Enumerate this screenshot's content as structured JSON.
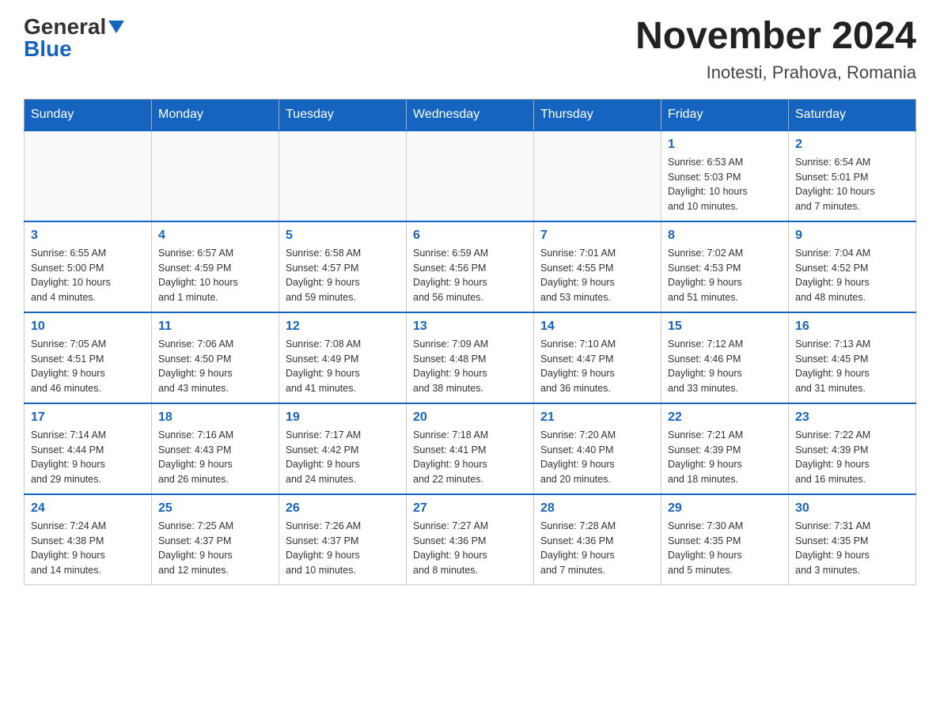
{
  "header": {
    "logo_general": "General",
    "logo_blue": "Blue",
    "title": "November 2024",
    "subtitle": "Inotesti, Prahova, Romania"
  },
  "weekdays": [
    "Sunday",
    "Monday",
    "Tuesday",
    "Wednesday",
    "Thursday",
    "Friday",
    "Saturday"
  ],
  "weeks": [
    [
      {
        "day": "",
        "info": ""
      },
      {
        "day": "",
        "info": ""
      },
      {
        "day": "",
        "info": ""
      },
      {
        "day": "",
        "info": ""
      },
      {
        "day": "",
        "info": ""
      },
      {
        "day": "1",
        "info": "Sunrise: 6:53 AM\nSunset: 5:03 PM\nDaylight: 10 hours\nand 10 minutes."
      },
      {
        "day": "2",
        "info": "Sunrise: 6:54 AM\nSunset: 5:01 PM\nDaylight: 10 hours\nand 7 minutes."
      }
    ],
    [
      {
        "day": "3",
        "info": "Sunrise: 6:55 AM\nSunset: 5:00 PM\nDaylight: 10 hours\nand 4 minutes."
      },
      {
        "day": "4",
        "info": "Sunrise: 6:57 AM\nSunset: 4:59 PM\nDaylight: 10 hours\nand 1 minute."
      },
      {
        "day": "5",
        "info": "Sunrise: 6:58 AM\nSunset: 4:57 PM\nDaylight: 9 hours\nand 59 minutes."
      },
      {
        "day": "6",
        "info": "Sunrise: 6:59 AM\nSunset: 4:56 PM\nDaylight: 9 hours\nand 56 minutes."
      },
      {
        "day": "7",
        "info": "Sunrise: 7:01 AM\nSunset: 4:55 PM\nDaylight: 9 hours\nand 53 minutes."
      },
      {
        "day": "8",
        "info": "Sunrise: 7:02 AM\nSunset: 4:53 PM\nDaylight: 9 hours\nand 51 minutes."
      },
      {
        "day": "9",
        "info": "Sunrise: 7:04 AM\nSunset: 4:52 PM\nDaylight: 9 hours\nand 48 minutes."
      }
    ],
    [
      {
        "day": "10",
        "info": "Sunrise: 7:05 AM\nSunset: 4:51 PM\nDaylight: 9 hours\nand 46 minutes."
      },
      {
        "day": "11",
        "info": "Sunrise: 7:06 AM\nSunset: 4:50 PM\nDaylight: 9 hours\nand 43 minutes."
      },
      {
        "day": "12",
        "info": "Sunrise: 7:08 AM\nSunset: 4:49 PM\nDaylight: 9 hours\nand 41 minutes."
      },
      {
        "day": "13",
        "info": "Sunrise: 7:09 AM\nSunset: 4:48 PM\nDaylight: 9 hours\nand 38 minutes."
      },
      {
        "day": "14",
        "info": "Sunrise: 7:10 AM\nSunset: 4:47 PM\nDaylight: 9 hours\nand 36 minutes."
      },
      {
        "day": "15",
        "info": "Sunrise: 7:12 AM\nSunset: 4:46 PM\nDaylight: 9 hours\nand 33 minutes."
      },
      {
        "day": "16",
        "info": "Sunrise: 7:13 AM\nSunset: 4:45 PM\nDaylight: 9 hours\nand 31 minutes."
      }
    ],
    [
      {
        "day": "17",
        "info": "Sunrise: 7:14 AM\nSunset: 4:44 PM\nDaylight: 9 hours\nand 29 minutes."
      },
      {
        "day": "18",
        "info": "Sunrise: 7:16 AM\nSunset: 4:43 PM\nDaylight: 9 hours\nand 26 minutes."
      },
      {
        "day": "19",
        "info": "Sunrise: 7:17 AM\nSunset: 4:42 PM\nDaylight: 9 hours\nand 24 minutes."
      },
      {
        "day": "20",
        "info": "Sunrise: 7:18 AM\nSunset: 4:41 PM\nDaylight: 9 hours\nand 22 minutes."
      },
      {
        "day": "21",
        "info": "Sunrise: 7:20 AM\nSunset: 4:40 PM\nDaylight: 9 hours\nand 20 minutes."
      },
      {
        "day": "22",
        "info": "Sunrise: 7:21 AM\nSunset: 4:39 PM\nDaylight: 9 hours\nand 18 minutes."
      },
      {
        "day": "23",
        "info": "Sunrise: 7:22 AM\nSunset: 4:39 PM\nDaylight: 9 hours\nand 16 minutes."
      }
    ],
    [
      {
        "day": "24",
        "info": "Sunrise: 7:24 AM\nSunset: 4:38 PM\nDaylight: 9 hours\nand 14 minutes."
      },
      {
        "day": "25",
        "info": "Sunrise: 7:25 AM\nSunset: 4:37 PM\nDaylight: 9 hours\nand 12 minutes."
      },
      {
        "day": "26",
        "info": "Sunrise: 7:26 AM\nSunset: 4:37 PM\nDaylight: 9 hours\nand 10 minutes."
      },
      {
        "day": "27",
        "info": "Sunrise: 7:27 AM\nSunset: 4:36 PM\nDaylight: 9 hours\nand 8 minutes."
      },
      {
        "day": "28",
        "info": "Sunrise: 7:28 AM\nSunset: 4:36 PM\nDaylight: 9 hours\nand 7 minutes."
      },
      {
        "day": "29",
        "info": "Sunrise: 7:30 AM\nSunset: 4:35 PM\nDaylight: 9 hours\nand 5 minutes."
      },
      {
        "day": "30",
        "info": "Sunrise: 7:31 AM\nSunset: 4:35 PM\nDaylight: 9 hours\nand 3 minutes."
      }
    ]
  ]
}
